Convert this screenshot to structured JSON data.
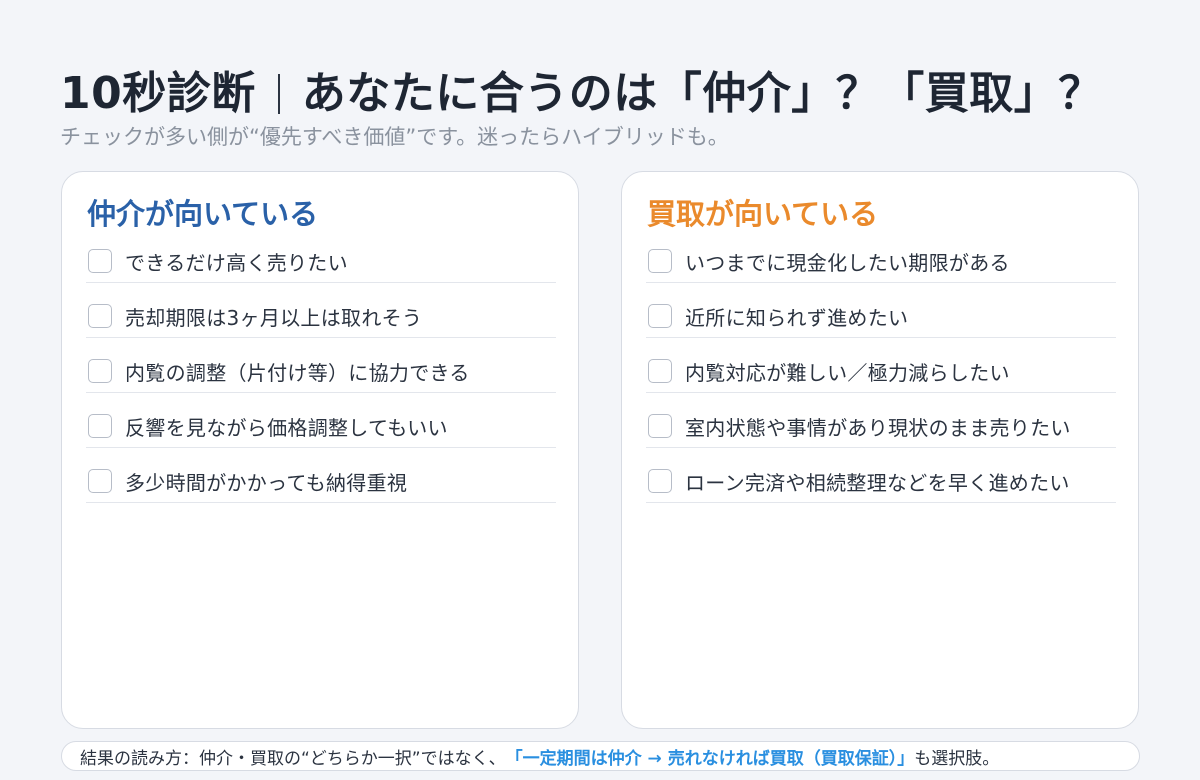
{
  "header": {
    "title_left": "10秒診断",
    "title_right": "あなたに合うのは「仲介」？「買取」？",
    "subtitle": "チェックが多い側が“優先すべき価値”です。迷ったらハイブリッドも。"
  },
  "colors": {
    "broker_accent": "#2a61a8",
    "buyout_accent": "#ea8a2c",
    "footer_emphasis": "#2a8fe0"
  },
  "broker_card": {
    "title": "仲介が向いている",
    "items": [
      {
        "label": "できるだけ高く売りたい",
        "checked": false
      },
      {
        "label": "売却期限は3ヶ月以上は取れそう",
        "checked": false
      },
      {
        "label": "内覧の調整（片付け等）に協力できる",
        "checked": false
      },
      {
        "label": "反響を見ながら価格調整してもいい",
        "checked": false
      },
      {
        "label": "多少時間がかかっても納得重視",
        "checked": false
      }
    ]
  },
  "buyout_card": {
    "title": "買取が向いている",
    "items": [
      {
        "label": "いつまでに現金化したい期限がある",
        "checked": false
      },
      {
        "label": "近所に知られず進めたい",
        "checked": false
      },
      {
        "label": "内覧対応が難しい／極力減らしたい",
        "checked": false
      },
      {
        "label": "室内状態や事情があり現状のまま売りたい",
        "checked": false
      },
      {
        "label": "ローン完済や相続整理などを早く進めたい",
        "checked": false
      }
    ]
  },
  "footer": {
    "prefix": "結果の読み方：仲介・買取の“どちらか一択”ではなく、",
    "emphasis": "「一定期間は仲介 → 売れなければ買取（買取保証）」",
    "suffix": "も選択肢。"
  }
}
